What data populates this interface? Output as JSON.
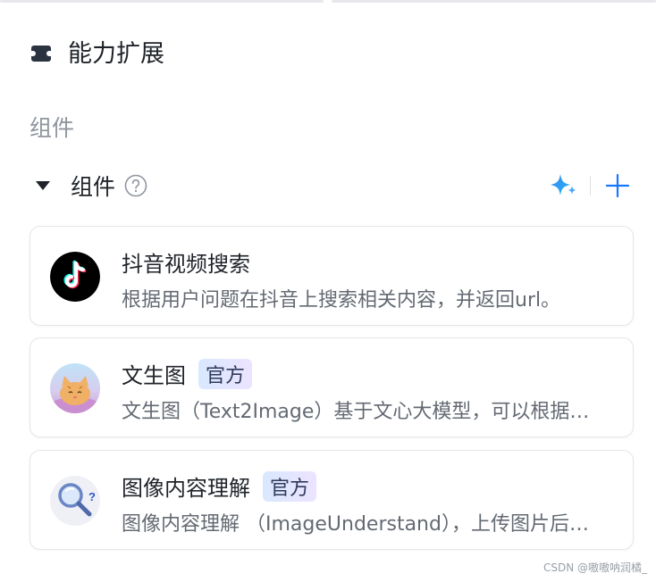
{
  "section": {
    "title": "能力扩展",
    "icon": "puzzle-icon"
  },
  "sub_label": "组件",
  "group": {
    "title": "组件",
    "help_icon": "help-icon",
    "actions": {
      "ai_icon": "sparkle-icon",
      "add_icon": "plus-icon"
    }
  },
  "plugins": [
    {
      "name": "抖音视频搜索",
      "badge": "",
      "desc": "根据用户问题在抖音上搜索相关内容，并返回url。",
      "icon": "tiktok-icon"
    },
    {
      "name": "文生图",
      "badge": "官方",
      "desc": "文生图（Text2Image）基于文心大模型，可以根据…",
      "icon": "cat-illustration-icon"
    },
    {
      "name": "图像内容理解",
      "badge": "官方",
      "desc": "图像内容理解 （ImageUnderstand），上传图片后…",
      "icon": "magnifier-question-icon"
    }
  ],
  "watermark": "CSDN @嗷嗷呐润橘_",
  "colors": {
    "accent": "#1677ff",
    "text_primary": "#1f2329",
    "text_secondary": "#646a73",
    "muted": "#8f959e"
  }
}
